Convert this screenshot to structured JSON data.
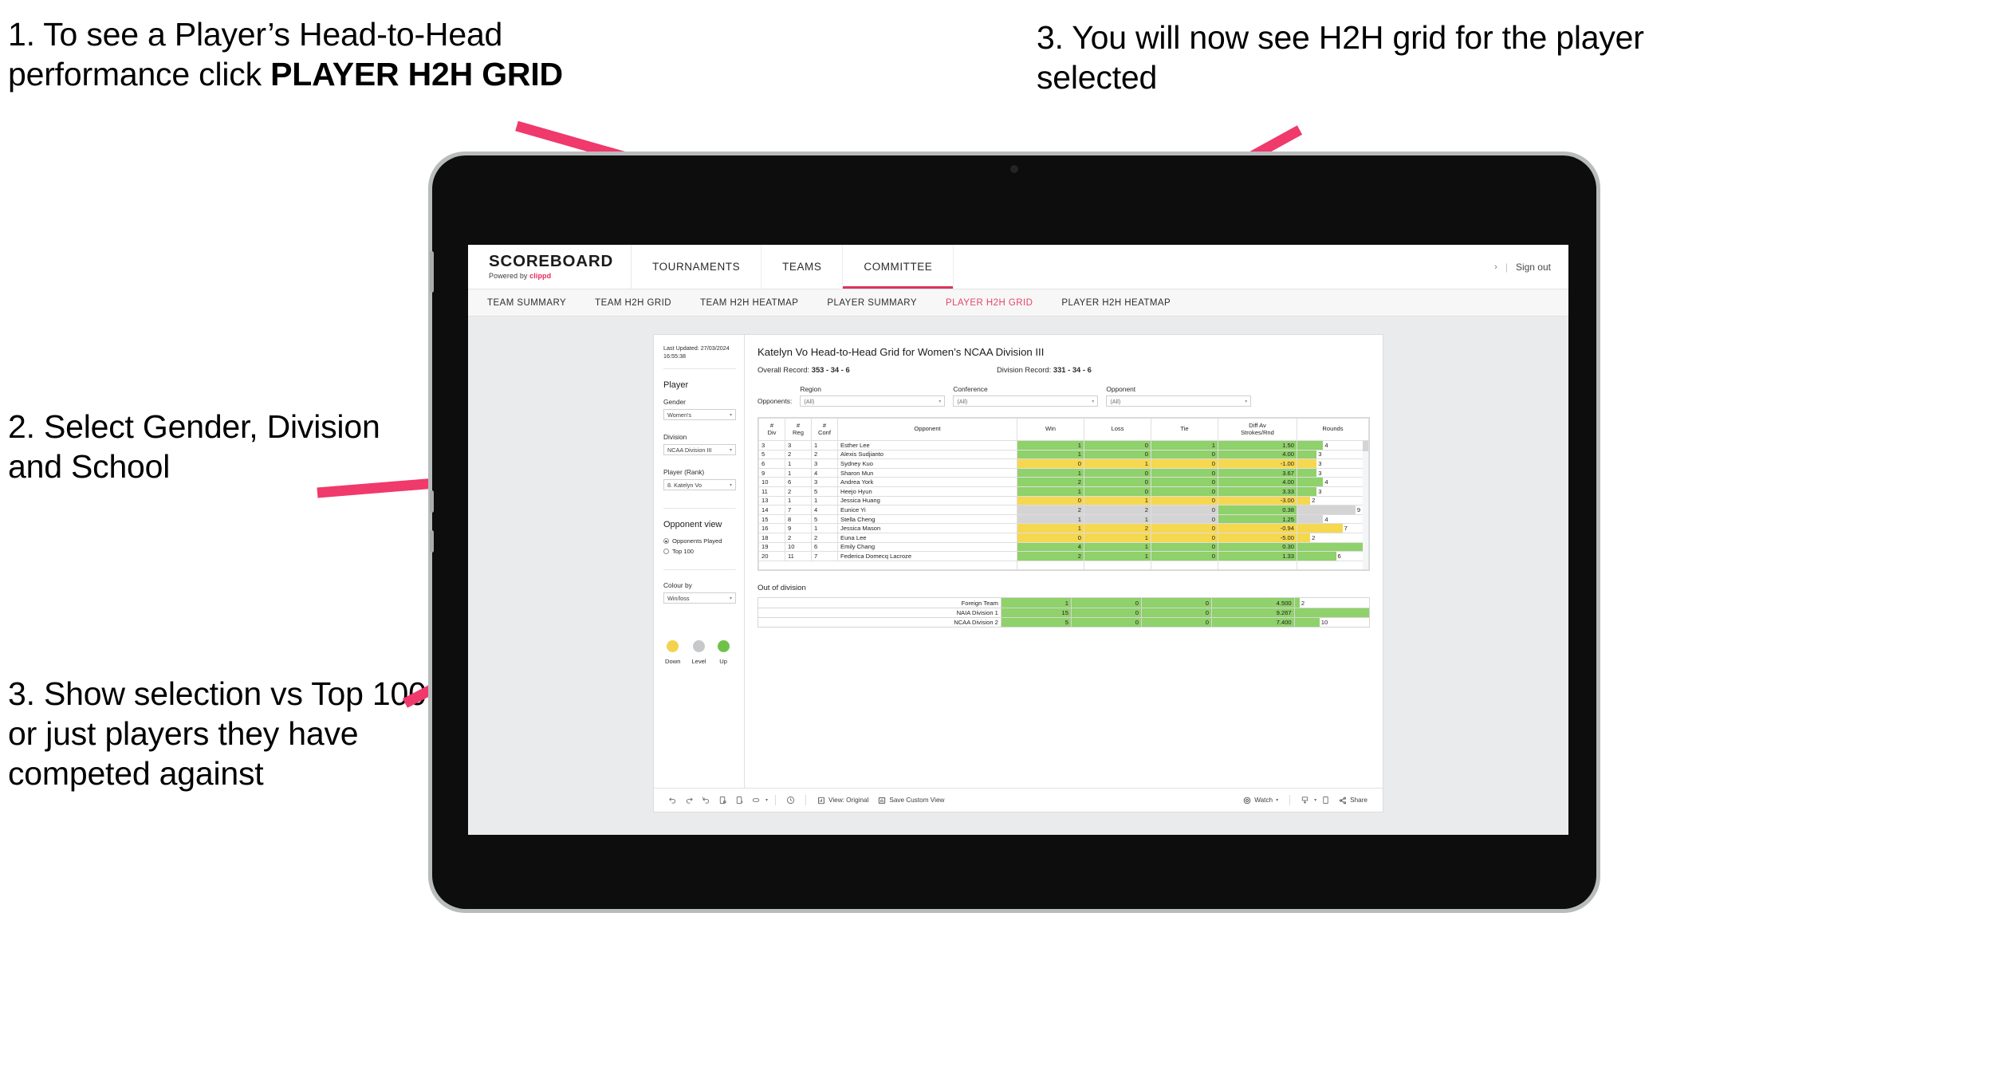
{
  "annotations": {
    "step1_lead": "1. To see a Player’s Head-to-Head performance click ",
    "step1_bold": "PLAYER H2H GRID",
    "step2": "2. Select Gender, Division and School",
    "step3_left": "3. Show selection vs Top 100 or just players they have competed against",
    "step3_right": "3. You will now see H2H grid for the player selected",
    "arrow_color": "#ef3a6b"
  },
  "app": {
    "brand": {
      "name": "SCOREBOARD",
      "powered_prefix": "Powered by ",
      "powered_brand": "clippd"
    },
    "topnav": [
      {
        "label": "TOURNAMENTS",
        "active": false
      },
      {
        "label": "TEAMS",
        "active": false
      },
      {
        "label": "COMMITTEE",
        "active": true
      }
    ],
    "account": {
      "chevron": "›",
      "separator": "|",
      "sign_out": "Sign out"
    },
    "subnav": [
      {
        "label": "TEAM SUMMARY",
        "active": false
      },
      {
        "label": "TEAM H2H GRID",
        "active": false
      },
      {
        "label": "TEAM H2H HEATMAP",
        "active": false
      },
      {
        "label": "PLAYER SUMMARY",
        "active": false
      },
      {
        "label": "PLAYER H2H GRID",
        "active": true
      },
      {
        "label": "PLAYER H2H HEATMAP",
        "active": false
      }
    ]
  },
  "sidebar": {
    "last_updated": "Last Updated: 27/03/2024 16:55:38",
    "player_heading": "Player",
    "fields": [
      {
        "label": "Gender",
        "value": "Women's"
      },
      {
        "label": "Division",
        "value": "NCAA Division III"
      },
      {
        "label": "Player (Rank)",
        "value": "8. Katelyn Vo"
      }
    ],
    "opponent_view": {
      "heading": "Opponent view",
      "options": [
        {
          "label": "Opponents Played",
          "selected": true
        },
        {
          "label": "Top 100",
          "selected": false
        }
      ]
    },
    "colour_by": {
      "label": "Colour by",
      "value": "Win/loss"
    },
    "legend": [
      {
        "label": "Down",
        "color": "#f3d24e"
      },
      {
        "label": "Level",
        "color": "#c6c8ca"
      },
      {
        "label": "Up",
        "color": "#6fc14a"
      }
    ]
  },
  "viz": {
    "title": "Katelyn Vo Head-to-Head Grid for Women’s NCAA Division III",
    "overall_record_label": "Overall Record: ",
    "overall_record_value": "353 - 34 - 6",
    "division_record_label": "Division Record: ",
    "division_record_value": "331 - 34 - 6",
    "opponents_label": "Opponents:",
    "filters": [
      {
        "label": "Region",
        "value": "(All)"
      },
      {
        "label": "Conference",
        "value": "(All)"
      },
      {
        "label": "Opponent",
        "value": "(All)"
      }
    ],
    "out_of_division_title": "Out of division"
  },
  "chart_data": {
    "type": "table",
    "title": "Katelyn Vo Head-to-Head Grid for Women’s NCAA Division III",
    "columns": [
      "# Div",
      "# Reg",
      "# Conf",
      "Opponent",
      "Win",
      "Loss",
      "Tie",
      "Diff Av Strokes/Rnd",
      "Rounds"
    ],
    "column_headers_multiline": [
      {
        "l1": "#",
        "l2": "Div"
      },
      {
        "l1": "#",
        "l2": "Reg"
      },
      {
        "l1": "#",
        "l2": "Conf"
      },
      {
        "l1": "Opponent",
        "l2": ""
      },
      {
        "l1": "Win",
        "l2": ""
      },
      {
        "l1": "Loss",
        "l2": ""
      },
      {
        "l1": "Tie",
        "l2": ""
      },
      {
        "l1": "Diff Av",
        "l2": "Strokes/Rnd"
      },
      {
        "l1": "Rounds",
        "l2": ""
      }
    ],
    "rounds_max": 11,
    "rows": [
      {
        "div": "3",
        "reg": "3",
        "conf": "1",
        "opponent": "Esther Lee",
        "win": "1",
        "loss": "0",
        "tie": "1",
        "diff": "1.50",
        "rounds": "4",
        "state": "win"
      },
      {
        "div": "5",
        "reg": "2",
        "conf": "2",
        "opponent": "Alexis Sudjianto",
        "win": "1",
        "loss": "0",
        "tie": "0",
        "diff": "4.00",
        "rounds": "3",
        "state": "win"
      },
      {
        "div": "6",
        "reg": "1",
        "conf": "3",
        "opponent": "Sydney Kuo",
        "win": "0",
        "loss": "1",
        "tie": "0",
        "diff": "-1.00",
        "rounds": "3",
        "state": "loss"
      },
      {
        "div": "9",
        "reg": "1",
        "conf": "4",
        "opponent": "Sharon Mun",
        "win": "1",
        "loss": "0",
        "tie": "0",
        "diff": "3.67",
        "rounds": "3",
        "state": "win"
      },
      {
        "div": "10",
        "reg": "6",
        "conf": "3",
        "opponent": "Andrea York",
        "win": "2",
        "loss": "0",
        "tie": "0",
        "diff": "4.00",
        "rounds": "4",
        "state": "win"
      },
      {
        "div": "11",
        "reg": "2",
        "conf": "5",
        "opponent": "Heejo Hyun",
        "win": "1",
        "loss": "0",
        "tie": "0",
        "diff": "3.33",
        "rounds": "3",
        "state": "win"
      },
      {
        "div": "13",
        "reg": "1",
        "conf": "1",
        "opponent": "Jessica Huang",
        "win": "0",
        "loss": "1",
        "tie": "0",
        "diff": "-3.00",
        "rounds": "2",
        "state": "loss"
      },
      {
        "div": "14",
        "reg": "7",
        "conf": "4",
        "opponent": "Eunice Yi",
        "win": "2",
        "loss": "2",
        "tie": "0",
        "diff": "0.38",
        "rounds": "9",
        "state": "level",
        "diff_state": "win"
      },
      {
        "div": "15",
        "reg": "8",
        "conf": "5",
        "opponent": "Stella Cheng",
        "win": "1",
        "loss": "1",
        "tie": "0",
        "diff": "1.25",
        "rounds": "4",
        "state": "level",
        "diff_state": "win"
      },
      {
        "div": "16",
        "reg": "9",
        "conf": "1",
        "opponent": "Jessica Mason",
        "win": "1",
        "loss": "2",
        "tie": "0",
        "diff": "-0.94",
        "rounds": "7",
        "state": "loss"
      },
      {
        "div": "18",
        "reg": "2",
        "conf": "2",
        "opponent": "Euna Lee",
        "win": "0",
        "loss": "1",
        "tie": "0",
        "diff": "-5.00",
        "rounds": "2",
        "state": "loss"
      },
      {
        "div": "19",
        "reg": "10",
        "conf": "6",
        "opponent": "Emily Chang",
        "win": "4",
        "loss": "1",
        "tie": "0",
        "diff": "0.30",
        "rounds": "11",
        "state": "win"
      },
      {
        "div": "20",
        "reg": "11",
        "conf": "7",
        "opponent": "Federica Domecq Lacroze",
        "win": "2",
        "loss": "1",
        "tie": "0",
        "diff": "1.33",
        "rounds": "6",
        "state": "win"
      }
    ],
    "out_of_division": {
      "title": "Out of division",
      "rounds_max": 30,
      "rows": [
        {
          "label": "Foreign Team",
          "win": "1",
          "loss": "0",
          "tie": "0",
          "diff": "4.500",
          "rounds": "2",
          "state": "win"
        },
        {
          "label": "NAIA Division 1",
          "win": "15",
          "loss": "0",
          "tie": "0",
          "diff": "9.267",
          "rounds": "30",
          "state": "win"
        },
        {
          "label": "NCAA Division 2",
          "win": "5",
          "loss": "0",
          "tie": "0",
          "diff": "7.400",
          "rounds": "10",
          "state": "win"
        }
      ]
    }
  },
  "toolbar": {
    "view_original": "View: Original",
    "save_custom_view": "Save Custom View",
    "watch": "Watch",
    "share": "Share",
    "caret": "▾"
  }
}
